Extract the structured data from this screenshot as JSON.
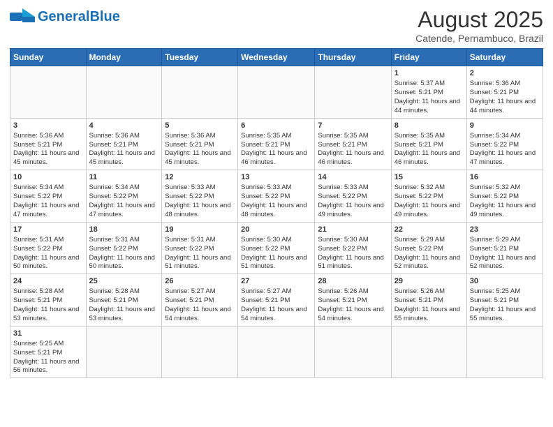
{
  "logo": {
    "general": "General",
    "blue": "Blue"
  },
  "title": "August 2025",
  "subtitle": "Catende, Pernambuco, Brazil",
  "weekdays": [
    "Sunday",
    "Monday",
    "Tuesday",
    "Wednesday",
    "Thursday",
    "Friday",
    "Saturday"
  ],
  "weeks": [
    [
      {
        "day": "",
        "info": ""
      },
      {
        "day": "",
        "info": ""
      },
      {
        "day": "",
        "info": ""
      },
      {
        "day": "",
        "info": ""
      },
      {
        "day": "",
        "info": ""
      },
      {
        "day": "1",
        "info": "Sunrise: 5:37 AM\nSunset: 5:21 PM\nDaylight: 11 hours\nand 44 minutes."
      },
      {
        "day": "2",
        "info": "Sunrise: 5:36 AM\nSunset: 5:21 PM\nDaylight: 11 hours\nand 44 minutes."
      }
    ],
    [
      {
        "day": "3",
        "info": "Sunrise: 5:36 AM\nSunset: 5:21 PM\nDaylight: 11 hours\nand 45 minutes."
      },
      {
        "day": "4",
        "info": "Sunrise: 5:36 AM\nSunset: 5:21 PM\nDaylight: 11 hours\nand 45 minutes."
      },
      {
        "day": "5",
        "info": "Sunrise: 5:36 AM\nSunset: 5:21 PM\nDaylight: 11 hours\nand 45 minutes."
      },
      {
        "day": "6",
        "info": "Sunrise: 5:35 AM\nSunset: 5:21 PM\nDaylight: 11 hours\nand 46 minutes."
      },
      {
        "day": "7",
        "info": "Sunrise: 5:35 AM\nSunset: 5:21 PM\nDaylight: 11 hours\nand 46 minutes."
      },
      {
        "day": "8",
        "info": "Sunrise: 5:35 AM\nSunset: 5:21 PM\nDaylight: 11 hours\nand 46 minutes."
      },
      {
        "day": "9",
        "info": "Sunrise: 5:34 AM\nSunset: 5:22 PM\nDaylight: 11 hours\nand 47 minutes."
      }
    ],
    [
      {
        "day": "10",
        "info": "Sunrise: 5:34 AM\nSunset: 5:22 PM\nDaylight: 11 hours\nand 47 minutes."
      },
      {
        "day": "11",
        "info": "Sunrise: 5:34 AM\nSunset: 5:22 PM\nDaylight: 11 hours\nand 47 minutes."
      },
      {
        "day": "12",
        "info": "Sunrise: 5:33 AM\nSunset: 5:22 PM\nDaylight: 11 hours\nand 48 minutes."
      },
      {
        "day": "13",
        "info": "Sunrise: 5:33 AM\nSunset: 5:22 PM\nDaylight: 11 hours\nand 48 minutes."
      },
      {
        "day": "14",
        "info": "Sunrise: 5:33 AM\nSunset: 5:22 PM\nDaylight: 11 hours\nand 49 minutes."
      },
      {
        "day": "15",
        "info": "Sunrise: 5:32 AM\nSunset: 5:22 PM\nDaylight: 11 hours\nand 49 minutes."
      },
      {
        "day": "16",
        "info": "Sunrise: 5:32 AM\nSunset: 5:22 PM\nDaylight: 11 hours\nand 49 minutes."
      }
    ],
    [
      {
        "day": "17",
        "info": "Sunrise: 5:31 AM\nSunset: 5:22 PM\nDaylight: 11 hours\nand 50 minutes."
      },
      {
        "day": "18",
        "info": "Sunrise: 5:31 AM\nSunset: 5:22 PM\nDaylight: 11 hours\nand 50 minutes."
      },
      {
        "day": "19",
        "info": "Sunrise: 5:31 AM\nSunset: 5:22 PM\nDaylight: 11 hours\nand 51 minutes."
      },
      {
        "day": "20",
        "info": "Sunrise: 5:30 AM\nSunset: 5:22 PM\nDaylight: 11 hours\nand 51 minutes."
      },
      {
        "day": "21",
        "info": "Sunrise: 5:30 AM\nSunset: 5:22 PM\nDaylight: 11 hours\nand 51 minutes."
      },
      {
        "day": "22",
        "info": "Sunrise: 5:29 AM\nSunset: 5:22 PM\nDaylight: 11 hours\nand 52 minutes."
      },
      {
        "day": "23",
        "info": "Sunrise: 5:29 AM\nSunset: 5:21 PM\nDaylight: 11 hours\nand 52 minutes."
      }
    ],
    [
      {
        "day": "24",
        "info": "Sunrise: 5:28 AM\nSunset: 5:21 PM\nDaylight: 11 hours\nand 53 minutes."
      },
      {
        "day": "25",
        "info": "Sunrise: 5:28 AM\nSunset: 5:21 PM\nDaylight: 11 hours\nand 53 minutes."
      },
      {
        "day": "26",
        "info": "Sunrise: 5:27 AM\nSunset: 5:21 PM\nDaylight: 11 hours\nand 54 minutes."
      },
      {
        "day": "27",
        "info": "Sunrise: 5:27 AM\nSunset: 5:21 PM\nDaylight: 11 hours\nand 54 minutes."
      },
      {
        "day": "28",
        "info": "Sunrise: 5:26 AM\nSunset: 5:21 PM\nDaylight: 11 hours\nand 54 minutes."
      },
      {
        "day": "29",
        "info": "Sunrise: 5:26 AM\nSunset: 5:21 PM\nDaylight: 11 hours\nand 55 minutes."
      },
      {
        "day": "30",
        "info": "Sunrise: 5:25 AM\nSunset: 5:21 PM\nDaylight: 11 hours\nand 55 minutes."
      }
    ],
    [
      {
        "day": "31",
        "info": "Sunrise: 5:25 AM\nSunset: 5:21 PM\nDaylight: 11 hours\nand 56 minutes."
      },
      {
        "day": "",
        "info": ""
      },
      {
        "day": "",
        "info": ""
      },
      {
        "day": "",
        "info": ""
      },
      {
        "day": "",
        "info": ""
      },
      {
        "day": "",
        "info": ""
      },
      {
        "day": "",
        "info": ""
      }
    ]
  ]
}
